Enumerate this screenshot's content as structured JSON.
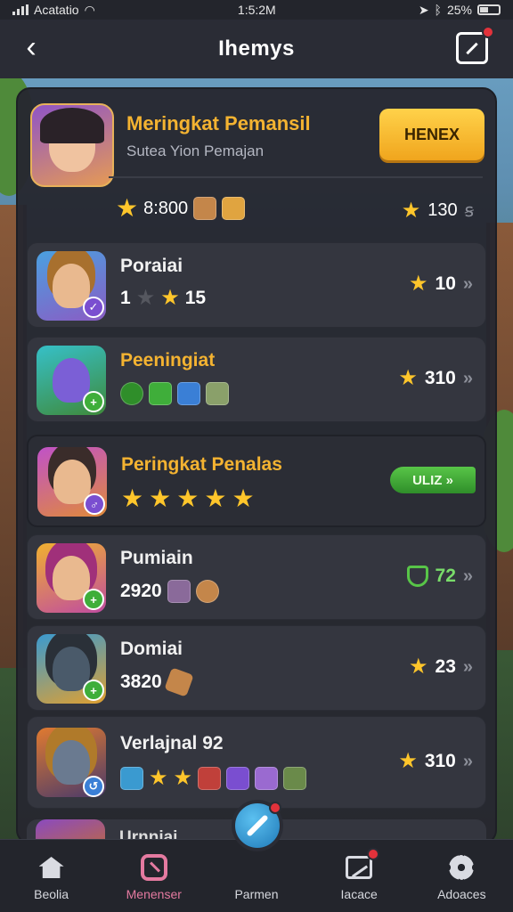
{
  "status_bar": {
    "carrier": "Acatatio",
    "time": "1:5:2M",
    "battery": "25%"
  },
  "header": {
    "title": "Ihemys"
  },
  "top_card": {
    "title": "Meringkat Pemansil",
    "subtitle": "Sutea Yion Pemajan",
    "button_label": "HENEX",
    "points": "8:800",
    "right_score": "130",
    "right_suffix": "ꞩ"
  },
  "rows": [
    {
      "name": "Poraiai",
      "left_num": "1",
      "count": "15",
      "score": "10"
    },
    {
      "name": "Peeningiat",
      "score": "310"
    },
    {
      "name": "Peringkat Penalas",
      "pill_label": "ULIZ"
    },
    {
      "name": "Pumiain",
      "value": "2920",
      "score": "72"
    },
    {
      "name": "Domiai",
      "value": "3820",
      "score": "23"
    },
    {
      "name": "Verlajnal 92",
      "score": "310"
    }
  ],
  "peek_row": {
    "name": "Urnniai"
  },
  "nav": {
    "items": [
      {
        "label": "Beolia",
        "icon": "home-icon"
      },
      {
        "label": "Menenser",
        "icon": "tag-icon"
      },
      {
        "label": "Parmen",
        "icon": "pen-icon"
      },
      {
        "label": "Iacace",
        "icon": "chart-icon"
      },
      {
        "label": "Adoaces",
        "icon": "gear-icon"
      }
    ]
  },
  "colors": {
    "accent_gold": "#f4b331",
    "star": "#ffc62b",
    "green": "#58c548",
    "pink": "#e47aa0",
    "badge_red": "#e2323b"
  }
}
